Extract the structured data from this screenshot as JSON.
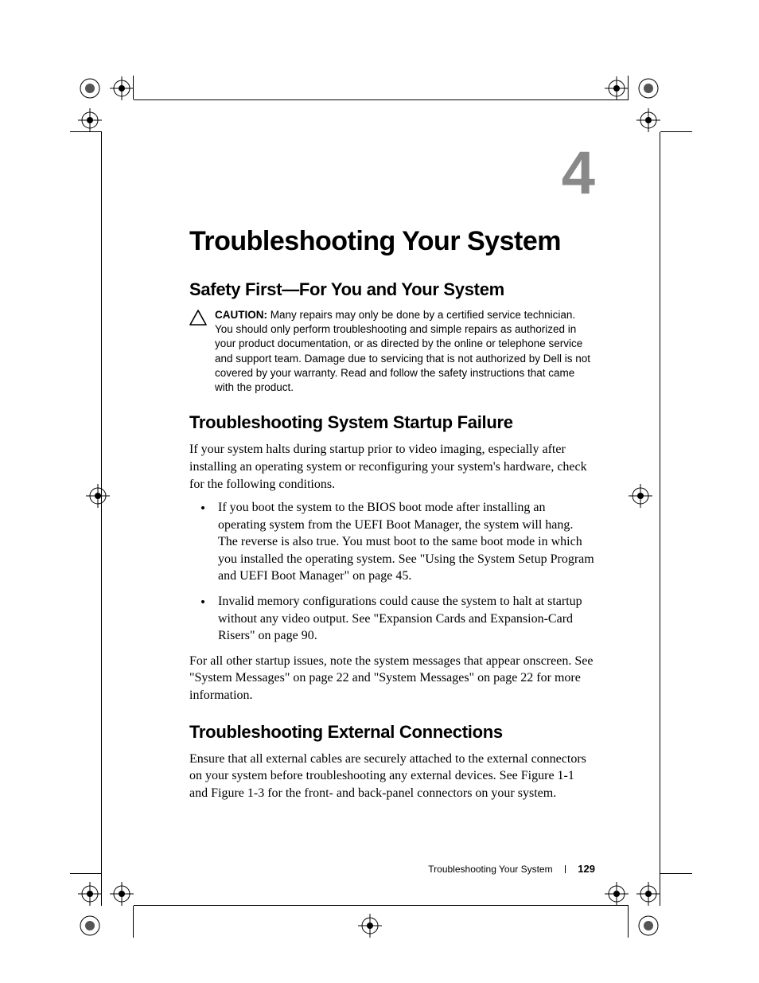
{
  "chapter_number": "4",
  "title": "Troubleshooting Your System",
  "sections": {
    "safety": {
      "heading": "Safety First—For You and Your System",
      "caution_label": "CAUTION: ",
      "caution_text": "Many repairs may only be done by a certified service technician. You should only perform troubleshooting and simple repairs as authorized in your product documentation, or as directed by the online or telephone service and support team. Damage due to servicing that is not authorized by Dell is not covered by your warranty. Read and follow the safety instructions that came with the product."
    },
    "startup": {
      "heading": "Troubleshooting System Startup Failure",
      "intro": "If your system halts during startup prior to video imaging, especially after installing an operating system or reconfiguring your system's hardware, check for the following conditions.",
      "bullets": [
        "If you boot the system to the BIOS boot mode after installing an operating system from the UEFI Boot Manager, the system will hang. The reverse is also true. You must boot to the same boot mode in which you installed the operating system. See \"Using the System Setup Program and UEFI Boot Manager\" on page 45.",
        "Invalid memory configurations could cause the system to halt at startup without any video output. See \"Expansion Cards and Expansion-Card Risers\" on page 90."
      ],
      "outro": "For all other startup issues, note the system messages that appear onscreen. See \"System Messages\" on page 22 and \"System Messages\" on page 22 for more information."
    },
    "external": {
      "heading": "Troubleshooting External Connections",
      "body": "Ensure that all external cables are securely attached to the external connectors on your system before troubleshooting any external devices. See Figure 1-1 and Figure 1-3 for the front- and back-panel connectors on your system."
    }
  },
  "footer": {
    "label": "Troubleshooting Your System",
    "page_number": "129"
  }
}
